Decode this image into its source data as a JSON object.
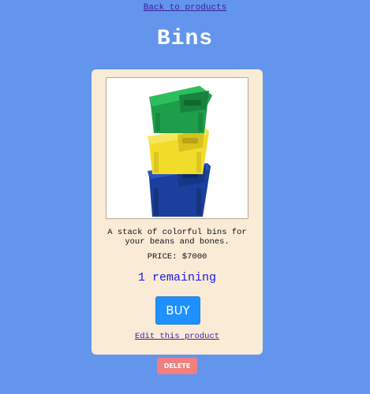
{
  "nav": {
    "back_label": "Back to products"
  },
  "product": {
    "title": "Bins",
    "image_alt": "Stack of green, yellow and blue recycling bins",
    "description": "A stack of colorful bins for your beans and bones.",
    "price_label": "PRICE: $7000",
    "remaining_label": "1 remaining",
    "buy_label": "BUY",
    "edit_label": "Edit this product",
    "delete_label": "DELETE"
  },
  "colors": {
    "background": "#6495ED",
    "card": "#FAEBD7",
    "buy": "#1E90FF",
    "delete": "#F08080",
    "remaining": "#1A1AE0",
    "bin_green": "#1E9E4A",
    "bin_yellow": "#F2DC2A",
    "bin_blue": "#1A3F9E"
  }
}
